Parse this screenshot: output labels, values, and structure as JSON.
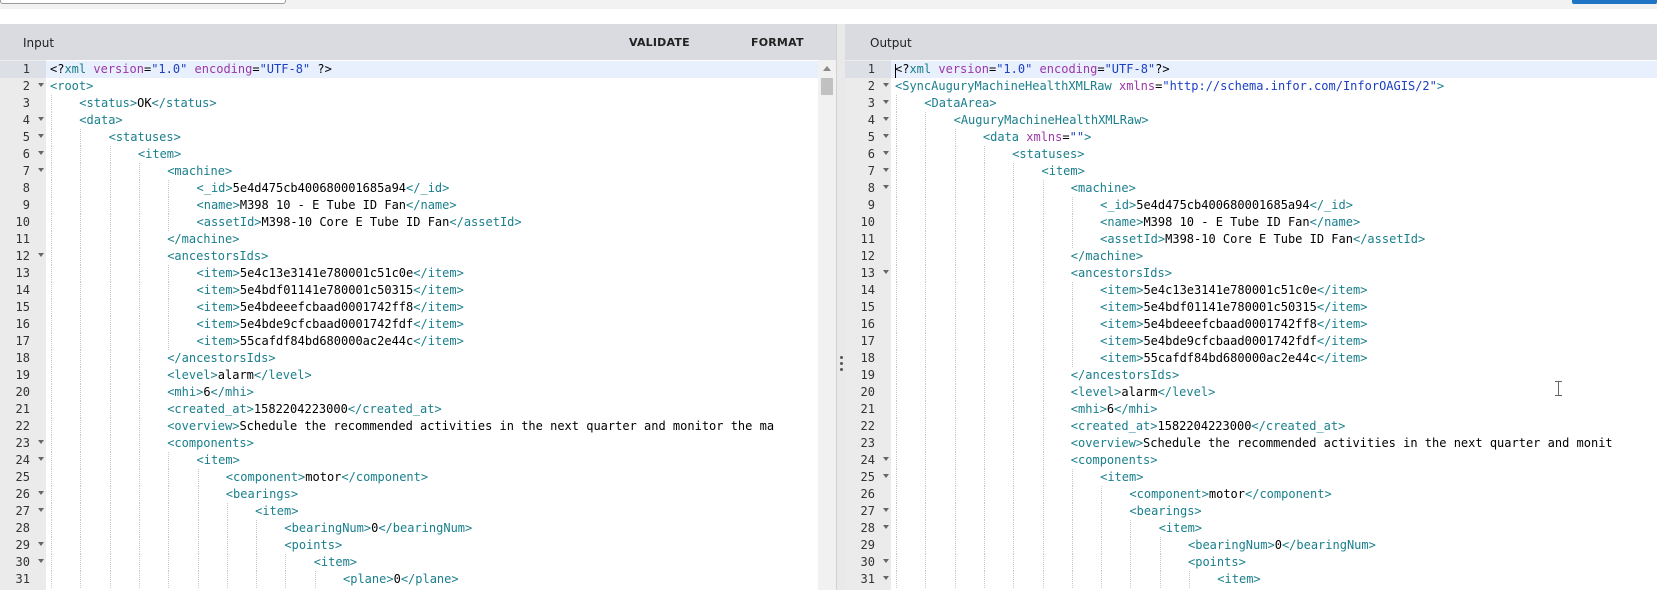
{
  "input_panel": {
    "title": "Input",
    "validate_label": "VALIDATE",
    "format_label": "FORMAT",
    "lines": [
      {
        "n": "1",
        "d": 0,
        "f": false,
        "t": [
          [
            "p",
            "<?"
          ],
          [
            "t",
            "xml"
          ],
          [
            "p",
            " "
          ],
          [
            "a",
            "version"
          ],
          [
            "p",
            "="
          ],
          [
            "v",
            "\"1.0\""
          ],
          [
            "p",
            " "
          ],
          [
            "a",
            "encoding"
          ],
          [
            "p",
            "="
          ],
          [
            "v",
            "\"UTF-8\""
          ],
          [
            "p",
            " ?>"
          ]
        ]
      },
      {
        "n": "2",
        "d": 0,
        "f": true,
        "t": [
          [
            "t",
            "<root>"
          ]
        ]
      },
      {
        "n": "3",
        "d": 1,
        "f": false,
        "t": [
          [
            "t",
            "<status>"
          ],
          [
            "p",
            "OK"
          ],
          [
            "t",
            "</status>"
          ]
        ]
      },
      {
        "n": "4",
        "d": 1,
        "f": true,
        "t": [
          [
            "t",
            "<data>"
          ]
        ]
      },
      {
        "n": "5",
        "d": 2,
        "f": true,
        "t": [
          [
            "t",
            "<statuses>"
          ]
        ]
      },
      {
        "n": "6",
        "d": 3,
        "f": true,
        "t": [
          [
            "t",
            "<item>"
          ]
        ]
      },
      {
        "n": "7",
        "d": 4,
        "f": true,
        "t": [
          [
            "t",
            "<machine>"
          ]
        ]
      },
      {
        "n": "8",
        "d": 5,
        "f": false,
        "t": [
          [
            "t",
            "<_id>"
          ],
          [
            "p",
            "5e4d475cb400680001685a94"
          ],
          [
            "t",
            "</_id>"
          ]
        ]
      },
      {
        "n": "9",
        "d": 5,
        "f": false,
        "t": [
          [
            "t",
            "<name>"
          ],
          [
            "p",
            "M398 10 - E Tube ID Fan"
          ],
          [
            "t",
            "</name>"
          ]
        ]
      },
      {
        "n": "10",
        "d": 5,
        "f": false,
        "t": [
          [
            "t",
            "<assetId>"
          ],
          [
            "p",
            "M398-10 Core E Tube ID Fan"
          ],
          [
            "t",
            "</assetId>"
          ]
        ]
      },
      {
        "n": "11",
        "d": 4,
        "f": false,
        "t": [
          [
            "t",
            "</machine>"
          ]
        ]
      },
      {
        "n": "12",
        "d": 4,
        "f": true,
        "t": [
          [
            "t",
            "<ancestorsIds>"
          ]
        ]
      },
      {
        "n": "13",
        "d": 5,
        "f": false,
        "t": [
          [
            "t",
            "<item>"
          ],
          [
            "p",
            "5e4c13e3141e780001c51c0e"
          ],
          [
            "t",
            "</item>"
          ]
        ]
      },
      {
        "n": "14",
        "d": 5,
        "f": false,
        "t": [
          [
            "t",
            "<item>"
          ],
          [
            "p",
            "5e4bdf01141e780001c50315"
          ],
          [
            "t",
            "</item>"
          ]
        ]
      },
      {
        "n": "15",
        "d": 5,
        "f": false,
        "t": [
          [
            "t",
            "<item>"
          ],
          [
            "p",
            "5e4bdeeefcbaad0001742ff8"
          ],
          [
            "t",
            "</item>"
          ]
        ]
      },
      {
        "n": "16",
        "d": 5,
        "f": false,
        "t": [
          [
            "t",
            "<item>"
          ],
          [
            "p",
            "5e4bde9cfcbaad0001742fdf"
          ],
          [
            "t",
            "</item>"
          ]
        ]
      },
      {
        "n": "17",
        "d": 5,
        "f": false,
        "t": [
          [
            "t",
            "<item>"
          ],
          [
            "p",
            "55cafdf84bd680000ac2e44c"
          ],
          [
            "t",
            "</item>"
          ]
        ]
      },
      {
        "n": "18",
        "d": 4,
        "f": false,
        "t": [
          [
            "t",
            "</ancestorsIds>"
          ]
        ]
      },
      {
        "n": "19",
        "d": 4,
        "f": false,
        "t": [
          [
            "t",
            "<level>"
          ],
          [
            "p",
            "alarm"
          ],
          [
            "t",
            "</level>"
          ]
        ]
      },
      {
        "n": "20",
        "d": 4,
        "f": false,
        "t": [
          [
            "t",
            "<mhi>"
          ],
          [
            "p",
            "6"
          ],
          [
            "t",
            "</mhi>"
          ]
        ]
      },
      {
        "n": "21",
        "d": 4,
        "f": false,
        "t": [
          [
            "t",
            "<created_at>"
          ],
          [
            "p",
            "1582204223000"
          ],
          [
            "t",
            "</created_at>"
          ]
        ]
      },
      {
        "n": "22",
        "d": 4,
        "f": false,
        "t": [
          [
            "t",
            "<overview>"
          ],
          [
            "p",
            "Schedule the recommended activities in the next quarter and monitor the ma"
          ]
        ]
      },
      {
        "n": "23",
        "d": 4,
        "f": true,
        "t": [
          [
            "t",
            "<components>"
          ]
        ]
      },
      {
        "n": "24",
        "d": 5,
        "f": true,
        "t": [
          [
            "t",
            "<item>"
          ]
        ]
      },
      {
        "n": "25",
        "d": 6,
        "f": false,
        "t": [
          [
            "t",
            "<component>"
          ],
          [
            "p",
            "motor"
          ],
          [
            "t",
            "</component>"
          ]
        ]
      },
      {
        "n": "26",
        "d": 6,
        "f": true,
        "t": [
          [
            "t",
            "<bearings>"
          ]
        ]
      },
      {
        "n": "27",
        "d": 7,
        "f": true,
        "t": [
          [
            "t",
            "<item>"
          ]
        ]
      },
      {
        "n": "28",
        "d": 8,
        "f": false,
        "t": [
          [
            "t",
            "<bearingNum>"
          ],
          [
            "p",
            "0"
          ],
          [
            "t",
            "</bearingNum>"
          ]
        ]
      },
      {
        "n": "29",
        "d": 8,
        "f": true,
        "t": [
          [
            "t",
            "<points>"
          ]
        ]
      },
      {
        "n": "30",
        "d": 9,
        "f": true,
        "t": [
          [
            "t",
            "<item>"
          ]
        ]
      },
      {
        "n": "31",
        "d": 10,
        "f": false,
        "t": [
          [
            "t",
            "<plane>"
          ],
          [
            "p",
            "0"
          ],
          [
            "t",
            "</plane>"
          ]
        ]
      }
    ]
  },
  "output_panel": {
    "title": "Output",
    "lines": [
      {
        "n": "1",
        "d": 0,
        "f": false,
        "t": [
          [
            "p",
            "<?"
          ],
          [
            "t",
            "xml"
          ],
          [
            "p",
            " "
          ],
          [
            "a",
            "version"
          ],
          [
            "p",
            "="
          ],
          [
            "v",
            "\"1.0\""
          ],
          [
            "p",
            " "
          ],
          [
            "a",
            "encoding"
          ],
          [
            "p",
            "="
          ],
          [
            "v",
            "\"UTF-8\""
          ],
          [
            "p",
            "?>"
          ]
        ]
      },
      {
        "n": "2",
        "d": 0,
        "f": true,
        "t": [
          [
            "t",
            "<SyncAuguryMachineHealthXMLRaw"
          ],
          [
            "p",
            " "
          ],
          [
            "a",
            "xmlns"
          ],
          [
            "p",
            "="
          ],
          [
            "v",
            "\"http://schema.infor.com/InforOAGIS/2\""
          ],
          [
            "t",
            ">"
          ]
        ]
      },
      {
        "n": "3",
        "d": 1,
        "f": true,
        "t": [
          [
            "t",
            "<DataArea>"
          ]
        ]
      },
      {
        "n": "4",
        "d": 2,
        "f": true,
        "t": [
          [
            "t",
            "<AuguryMachineHealthXMLRaw>"
          ]
        ]
      },
      {
        "n": "5",
        "d": 3,
        "f": true,
        "t": [
          [
            "t",
            "<data"
          ],
          [
            "p",
            " "
          ],
          [
            "a",
            "xmlns"
          ],
          [
            "p",
            "="
          ],
          [
            "v",
            "\"\""
          ],
          [
            "t",
            ">"
          ]
        ]
      },
      {
        "n": "6",
        "d": 4,
        "f": true,
        "t": [
          [
            "t",
            "<statuses>"
          ]
        ]
      },
      {
        "n": "7",
        "d": 5,
        "f": true,
        "t": [
          [
            "t",
            "<item>"
          ]
        ]
      },
      {
        "n": "8",
        "d": 6,
        "f": true,
        "t": [
          [
            "t",
            "<machine>"
          ]
        ]
      },
      {
        "n": "9",
        "d": 7,
        "f": false,
        "t": [
          [
            "t",
            "<_id>"
          ],
          [
            "p",
            "5e4d475cb400680001685a94"
          ],
          [
            "t",
            "</_id>"
          ]
        ]
      },
      {
        "n": "10",
        "d": 7,
        "f": false,
        "t": [
          [
            "t",
            "<name>"
          ],
          [
            "p",
            "M398 10 - E Tube ID Fan"
          ],
          [
            "t",
            "</name>"
          ]
        ]
      },
      {
        "n": "11",
        "d": 7,
        "f": false,
        "t": [
          [
            "t",
            "<assetId>"
          ],
          [
            "p",
            "M398-10 Core E Tube ID Fan"
          ],
          [
            "t",
            "</assetId>"
          ]
        ]
      },
      {
        "n": "12",
        "d": 6,
        "f": false,
        "t": [
          [
            "t",
            "</machine>"
          ]
        ]
      },
      {
        "n": "13",
        "d": 6,
        "f": true,
        "t": [
          [
            "t",
            "<ancestorsIds>"
          ]
        ]
      },
      {
        "n": "14",
        "d": 7,
        "f": false,
        "t": [
          [
            "t",
            "<item>"
          ],
          [
            "p",
            "5e4c13e3141e780001c51c0e"
          ],
          [
            "t",
            "</item>"
          ]
        ]
      },
      {
        "n": "15",
        "d": 7,
        "f": false,
        "t": [
          [
            "t",
            "<item>"
          ],
          [
            "p",
            "5e4bdf01141e780001c50315"
          ],
          [
            "t",
            "</item>"
          ]
        ]
      },
      {
        "n": "16",
        "d": 7,
        "f": false,
        "t": [
          [
            "t",
            "<item>"
          ],
          [
            "p",
            "5e4bdeeefcbaad0001742ff8"
          ],
          [
            "t",
            "</item>"
          ]
        ]
      },
      {
        "n": "17",
        "d": 7,
        "f": false,
        "t": [
          [
            "t",
            "<item>"
          ],
          [
            "p",
            "5e4bde9cfcbaad0001742fdf"
          ],
          [
            "t",
            "</item>"
          ]
        ]
      },
      {
        "n": "18",
        "d": 7,
        "f": false,
        "t": [
          [
            "t",
            "<item>"
          ],
          [
            "p",
            "55cafdf84bd680000ac2e44c"
          ],
          [
            "t",
            "</item>"
          ]
        ]
      },
      {
        "n": "19",
        "d": 6,
        "f": false,
        "t": [
          [
            "t",
            "</ancestorsIds>"
          ]
        ]
      },
      {
        "n": "20",
        "d": 6,
        "f": false,
        "t": [
          [
            "t",
            "<level>"
          ],
          [
            "p",
            "alarm"
          ],
          [
            "t",
            "</level>"
          ]
        ]
      },
      {
        "n": "21",
        "d": 6,
        "f": false,
        "t": [
          [
            "t",
            "<mhi>"
          ],
          [
            "p",
            "6"
          ],
          [
            "t",
            "</mhi>"
          ]
        ]
      },
      {
        "n": "22",
        "d": 6,
        "f": false,
        "t": [
          [
            "t",
            "<created_at>"
          ],
          [
            "p",
            "1582204223000"
          ],
          [
            "t",
            "</created_at>"
          ]
        ]
      },
      {
        "n": "23",
        "d": 6,
        "f": false,
        "t": [
          [
            "t",
            "<overview>"
          ],
          [
            "p",
            "Schedule the recommended activities in the next quarter and monit"
          ]
        ]
      },
      {
        "n": "24",
        "d": 6,
        "f": true,
        "t": [
          [
            "t",
            "<components>"
          ]
        ]
      },
      {
        "n": "25",
        "d": 7,
        "f": true,
        "t": [
          [
            "t",
            "<item>"
          ]
        ]
      },
      {
        "n": "26",
        "d": 8,
        "f": false,
        "t": [
          [
            "t",
            "<component>"
          ],
          [
            "p",
            "motor"
          ],
          [
            "t",
            "</component>"
          ]
        ]
      },
      {
        "n": "27",
        "d": 8,
        "f": true,
        "t": [
          [
            "t",
            "<bearings>"
          ]
        ]
      },
      {
        "n": "28",
        "d": 9,
        "f": true,
        "t": [
          [
            "t",
            "<item>"
          ]
        ]
      },
      {
        "n": "29",
        "d": 10,
        "f": false,
        "t": [
          [
            "t",
            "<bearingNum>"
          ],
          [
            "p",
            "0"
          ],
          [
            "t",
            "</bearingNum>"
          ]
        ]
      },
      {
        "n": "30",
        "d": 10,
        "f": true,
        "t": [
          [
            "t",
            "<points>"
          ]
        ]
      },
      {
        "n": "31",
        "d": 11,
        "f": true,
        "t": [
          [
            "t",
            "<item>"
          ]
        ]
      }
    ]
  }
}
